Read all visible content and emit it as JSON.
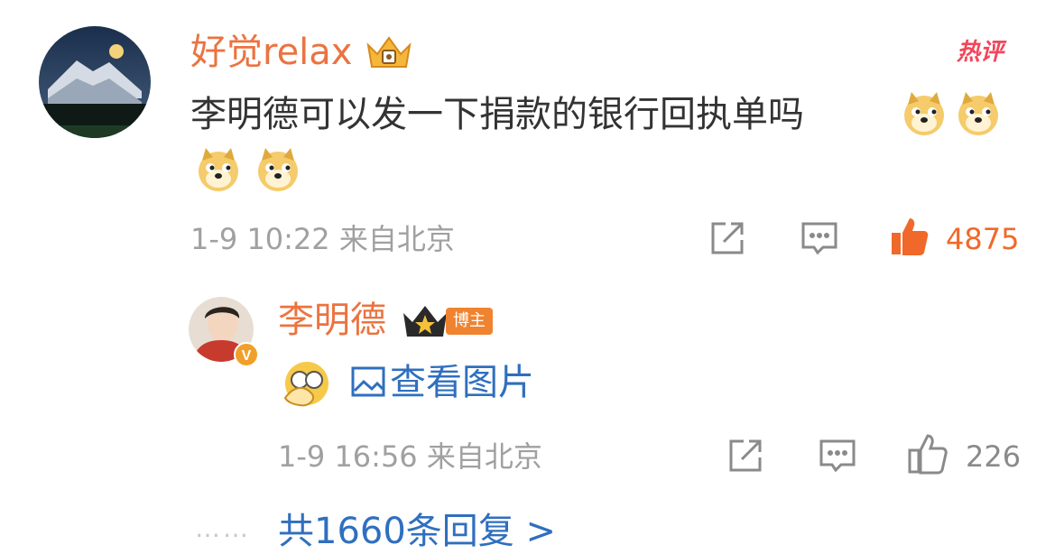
{
  "comment": {
    "username": "好觉relax",
    "hot_badge": "热评",
    "text": "李明德可以发一下捐款的银行回执单吗",
    "emojis": [
      "doge",
      "doge",
      "doge",
      "doge"
    ],
    "date": "1-9",
    "time": "10:22",
    "location": "来自北京",
    "likes": "4875",
    "liked": true
  },
  "reply": {
    "username": "李明德",
    "role_badge": "博主",
    "verified_badge": "V",
    "emoji": "facepalm-emoji",
    "view_image_label": "查看图片",
    "date": "1-9",
    "time": "16:56",
    "location": "来自北京",
    "likes": "226"
  },
  "more_replies": {
    "dots": "……",
    "label": "共1660条回复 >"
  },
  "colors": {
    "username": "#eb7340",
    "like_active": "#f0692a",
    "link": "#2f6fbf",
    "meta": "#a0a0a0",
    "hot": "#f2465a"
  }
}
